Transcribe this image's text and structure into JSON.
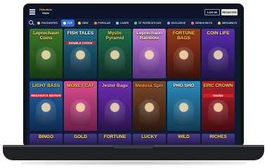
{
  "header": {
    "logo_line1": "Fabulous",
    "logo_line2": "Slots",
    "login_label": "LOG IN",
    "register_label": "REGISTER"
  },
  "nav": {
    "tabs": [
      {
        "label": "FAVOURITES",
        "icon": "star-icon",
        "color": "#f1c84b",
        "active": false
      },
      {
        "label": "TOP",
        "icon": "trophy-icon",
        "color": "#ffffff",
        "active": true
      },
      {
        "label": "NEW",
        "icon": "sparkle-icon",
        "color": "#ffd84a",
        "active": false
      },
      {
        "label": "POPULAR",
        "icon": "flame-icon",
        "color": "#ff7a3d",
        "active": false
      },
      {
        "label": "LASER",
        "icon": "bolt-icon",
        "color": "#7fd3ff",
        "active": false
      },
      {
        "label": "ST PATRICK'S DAY",
        "icon": "clover-icon",
        "color": "#4cd964",
        "active": false
      },
      {
        "label": "EXCLUSIVE",
        "icon": "diamond-icon",
        "color": "#b38bff",
        "active": false
      },
      {
        "label": "BONUS BUYS",
        "icon": "gift-icon",
        "color": "#ff6b9a",
        "active": false
      },
      {
        "label": "MEGAWAYS",
        "icon": "crown-icon",
        "color": "#ffc24a",
        "active": false
      }
    ]
  },
  "games": [
    {
      "name": "Leprechaun Coins",
      "sub": "",
      "bg": "#3c7a2a",
      "bg2": "#173d12",
      "title_color": "#ffe27a"
    },
    {
      "name": "FISH TALES",
      "sub": "DOUBLE CATCH",
      "bg": "#1f6e8a",
      "bg2": "#0b2b3d",
      "title_color": "#ffffff"
    },
    {
      "name": "Mystic Pyramid",
      "sub": "",
      "bg": "#1d6f4a",
      "bg2": "#0d2e25",
      "title_color": "#ffd64a"
    },
    {
      "name": "Leprechaun Rainbow",
      "sub": "",
      "bg": "#c67bd6",
      "bg2": "#5a2f86",
      "title_color": "#ffffff"
    },
    {
      "name": "FORTUNE BAGS",
      "sub": "",
      "bg": "#9b3a1c",
      "bg2": "#3b1208",
      "title_color": "#ffd54a"
    },
    {
      "name": "COIN LIFE",
      "sub": "",
      "bg": "#5a2db0",
      "bg2": "#21124a",
      "title_color": "#ffe27a"
    },
    {
      "name": "LIGHT BASS",
      "sub": "MEGAWAYS EDITION",
      "bg": "#2266a8",
      "bg2": "#0d2a52",
      "title_color": "#ffd64a"
    },
    {
      "name": "MONEY CAT",
      "sub": "",
      "bg": "#e14f8f",
      "bg2": "#6d1d4a",
      "title_color": "#ffd54a"
    },
    {
      "name": "Jester Bags",
      "sub": "",
      "bg": "#6e2fb6",
      "bg2": "#2a124b",
      "title_color": "#ffb3e0"
    },
    {
      "name": "Medusa Spin",
      "sub": "",
      "bg": "#7a4a2a",
      "bg2": "#2c170b",
      "title_color": "#ff9a4a"
    },
    {
      "name": "PHO SHO",
      "sub": "",
      "bg": "#2a8fbf",
      "bg2": "#113a54",
      "title_color": "#ffffff"
    },
    {
      "name": "EPIC CROWN",
      "sub": "Double",
      "bg": "#b3202a",
      "bg2": "#4a0a10",
      "title_color": "#ffd54a"
    }
  ],
  "partial_row": [
    "BINGO",
    "GOLD",
    "FORTUNE",
    "LUCKY",
    "WILD",
    "RICHES"
  ]
}
